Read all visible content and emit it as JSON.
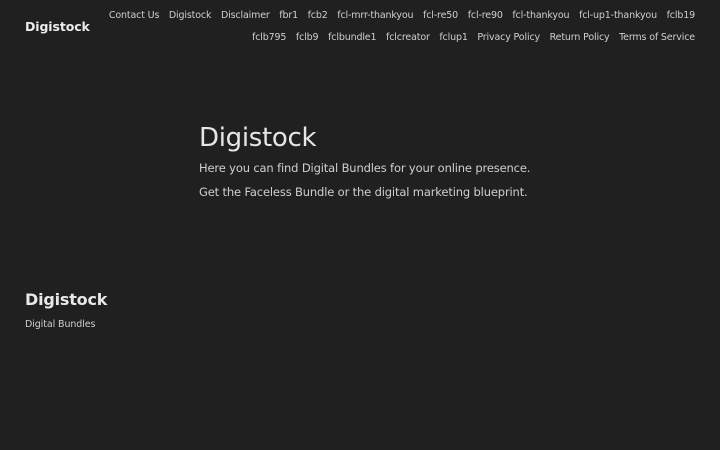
{
  "header": {
    "site_title": "Digistock",
    "nav": [
      "Contact Us",
      "Digistock",
      "Disclaimer",
      "fbr1",
      "fcb2",
      "fcl-mrr-thankyou",
      "fcl-re50",
      "fcl-re90",
      "fcl-thankyou",
      "fcl-up1-thankyou",
      "fclb19",
      "fclb795",
      "fclb9",
      "fclbundle1",
      "fclcreator",
      "fclup1",
      "Privacy Policy",
      "Return Policy",
      "Terms of Service"
    ]
  },
  "main": {
    "title": "Digistock",
    "line1": "Here you can find Digital Bundles for your online presence.",
    "line2": "Get the Faceless Bundle or the digital marketing blueprint."
  },
  "footer": {
    "title": "Digistock",
    "tagline": "Digital Bundles"
  }
}
